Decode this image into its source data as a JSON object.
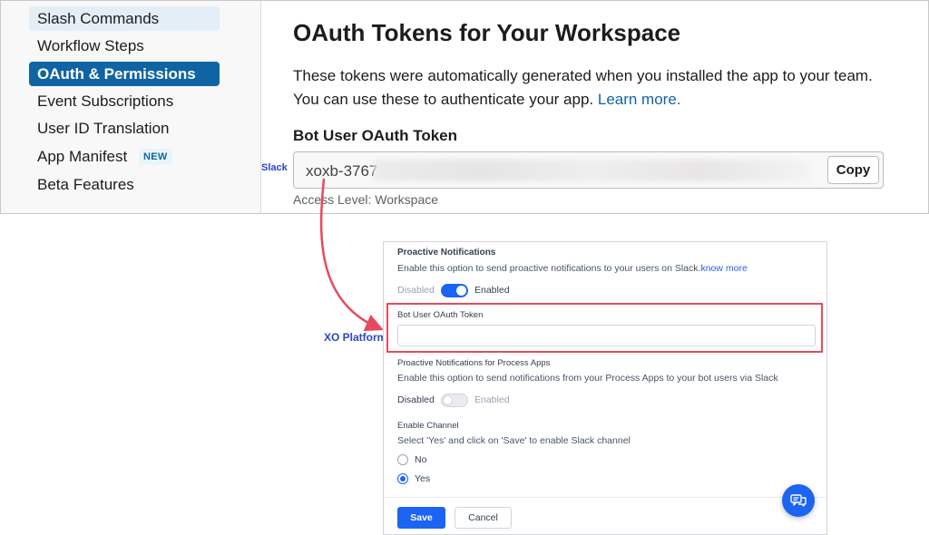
{
  "slack": {
    "sidebar": {
      "items": [
        {
          "label": "Slash Commands"
        },
        {
          "label": "Workflow Steps"
        },
        {
          "label": "OAuth & Permissions"
        },
        {
          "label": "Event Subscriptions"
        },
        {
          "label": "User ID Translation"
        },
        {
          "label": "App Manifest",
          "badge": "NEW"
        },
        {
          "label": "Beta Features"
        }
      ],
      "active_item": "OAuth & Permissions"
    },
    "main": {
      "title": "OAuth Tokens for Your Workspace",
      "description": "These tokens were automatically generated when you installed the app to your team. You can use these to authenticate your app.",
      "learn_more": "Learn more.",
      "token_label": "Bot User OAuth Token",
      "token_value_visible": "xoxb-3767",
      "copy_label": "Copy",
      "access_level": "Access Level: Workspace"
    }
  },
  "labels": {
    "slack": "Slack",
    "xo_platform": "XO Platform"
  },
  "xo": {
    "proactive": {
      "title": "Proactive Notifications",
      "description": "Enable this option to send proactive notifications to your users on Slack.",
      "link": "know more",
      "off_label": "Disabled",
      "on_label": "Enabled",
      "enabled": true
    },
    "bot_token": {
      "label": "Bot User OAuth Token",
      "value": ""
    },
    "process_apps": {
      "title": "Proactive Notifications for Process Apps",
      "description": "Enable this option to send notifications from your Process Apps to your bot users via Slack",
      "off_label": "Disabled",
      "on_label": "Enabled",
      "enabled": false
    },
    "channel": {
      "title": "Enable Channel",
      "description": "Select 'Yes' and click on 'Save' to enable Slack channel",
      "options": [
        "No",
        "Yes"
      ],
      "selected": "Yes"
    },
    "footer": {
      "save_label": "Save",
      "cancel_label": "Cancel"
    }
  },
  "colors": {
    "slack_active": "#1164a3",
    "slack_link": "#1264a3",
    "xo_primary": "#1c64f2",
    "annotation": "#2b46c8",
    "highlight": "#e74a5e"
  }
}
